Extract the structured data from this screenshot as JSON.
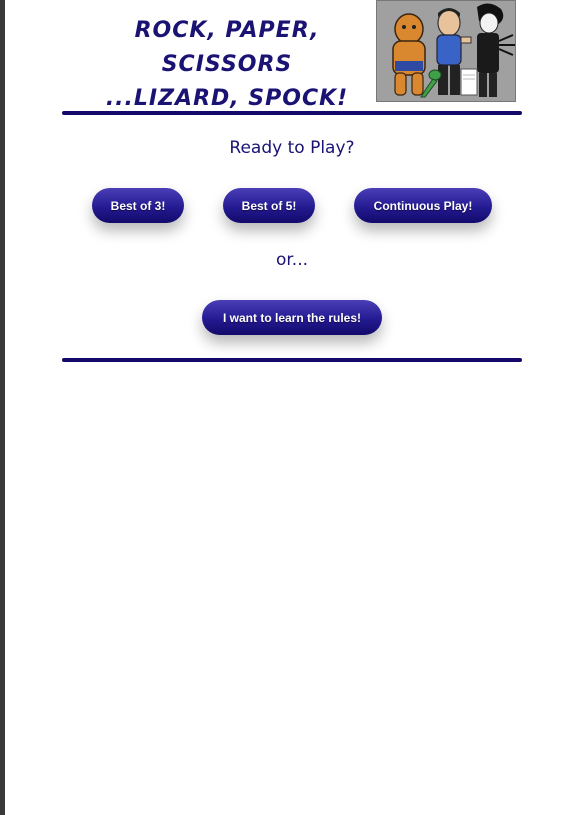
{
  "header": {
    "title_line1": "ROCK, PAPER, SCISSORS",
    "title_line2": "...LIZARD, SPOCK!"
  },
  "main": {
    "prompt": "Ready to Play?",
    "buttons": [
      {
        "label": "Best of 3!"
      },
      {
        "label": "Best of 5!"
      },
      {
        "label": "Continuous Play!"
      }
    ],
    "or_text": "or...",
    "rules_button": "I want to learn the rules!"
  },
  "colors": {
    "accent": "#1a1373",
    "button_top": "#4a3fb6",
    "button_bottom": "#120a6a",
    "divider": "#14086a"
  }
}
